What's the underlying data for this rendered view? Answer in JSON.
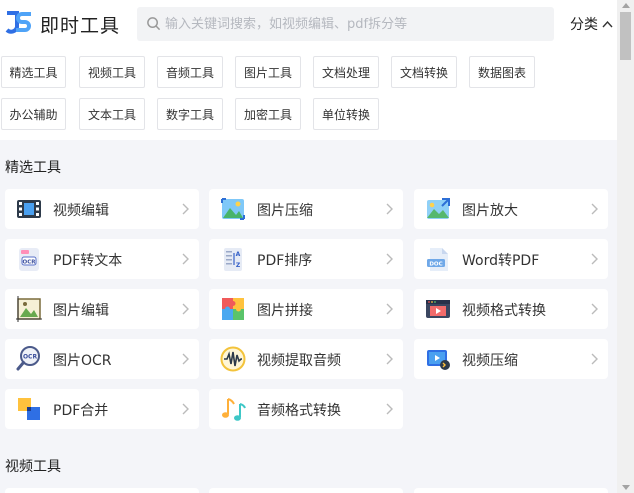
{
  "header": {
    "title": "即时工具",
    "search_placeholder": "输入关键词搜索，如视频编辑、pdf拆分等",
    "category_label": "分类",
    "brand_color": "#2f6fe4"
  },
  "tags": [
    "精选工具",
    "视频工具",
    "音频工具",
    "图片工具",
    "文档处理",
    "文档转换",
    "数据图表",
    "办公辅助",
    "文本工具",
    "数字工具",
    "加密工具",
    "单位转换"
  ],
  "featured": {
    "title": "精选工具",
    "tools": [
      {
        "label": "视频编辑",
        "icon": "film-icon"
      },
      {
        "label": "图片压缩",
        "icon": "image-compress-icon"
      },
      {
        "label": "图片放大",
        "icon": "image-enlarge-icon"
      },
      {
        "label": "PDF转文本",
        "icon": "ocr-doc-icon"
      },
      {
        "label": "PDF排序",
        "icon": "sort-az-icon"
      },
      {
        "label": "Word转PDF",
        "icon": "doc-file-icon"
      },
      {
        "label": "图片编辑",
        "icon": "image-edit-icon"
      },
      {
        "label": "图片拼接",
        "icon": "puzzle-icon"
      },
      {
        "label": "视频格式转换",
        "icon": "video-window-icon"
      },
      {
        "label": "图片OCR",
        "icon": "ocr-magnifier-icon"
      },
      {
        "label": "视频提取音频",
        "icon": "waveform-icon"
      },
      {
        "label": "视频压缩",
        "icon": "video-compress-icon"
      },
      {
        "label": "PDF合并",
        "icon": "merge-squares-icon"
      },
      {
        "label": "音频格式转换",
        "icon": "music-notes-icon"
      }
    ]
  },
  "video_section": {
    "title": "视频工具"
  }
}
